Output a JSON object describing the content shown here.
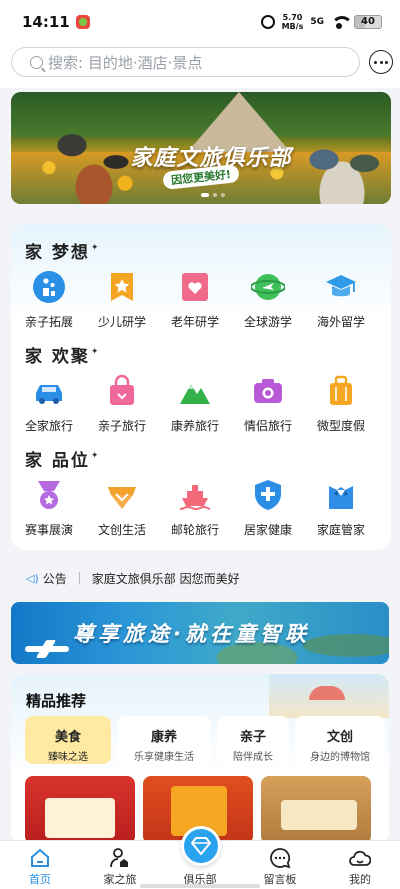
{
  "status_bar": {
    "time": "14:11",
    "speed": "5.70",
    "speed_unit": "MB/s",
    "network": "5G",
    "battery": "40",
    "battery_level": 0.4
  },
  "search": {
    "placeholder": "搜索: 目的地·酒店·景点"
  },
  "banner": {
    "title": "家庭文旅俱乐部",
    "subtitle": "因您更美好!",
    "slide_count": 3,
    "active_slide": 0
  },
  "sections": [
    {
      "title": "家 梦想",
      "items": [
        {
          "label": "亲子拓展",
          "icon": "parent-child-icon",
          "color": "#2a90e6"
        },
        {
          "label": "少儿研学",
          "icon": "bookmark-star-icon",
          "color": "#f5a524"
        },
        {
          "label": "老年研学",
          "icon": "heart-card-icon",
          "color": "#f06b8a"
        },
        {
          "label": "全球游学",
          "icon": "globe-plane-icon",
          "color": "#3fbf5a"
        },
        {
          "label": "海外留学",
          "icon": "graduation-cap-icon",
          "color": "#2f9be8"
        }
      ]
    },
    {
      "title": "家 欢聚",
      "items": [
        {
          "label": "全家旅行",
          "icon": "car-icon",
          "color": "#2a8de6"
        },
        {
          "label": "亲子旅行",
          "icon": "shopping-bag-icon",
          "color": "#f0679a"
        },
        {
          "label": "康养旅行",
          "icon": "mountain-icon",
          "color": "#33b24a"
        },
        {
          "label": "情侣旅行",
          "icon": "camera-icon",
          "color": "#b85ad8"
        },
        {
          "label": "微型度假",
          "icon": "suitcase-icon",
          "color": "#f5a623"
        }
      ]
    },
    {
      "title": "家 品位",
      "items": [
        {
          "label": "赛事展演",
          "icon": "medal-icon",
          "color": "#b66ae0"
        },
        {
          "label": "文创生活",
          "icon": "gem-box-icon",
          "color": "#f4a12a"
        },
        {
          "label": "邮轮旅行",
          "icon": "cruise-ship-icon",
          "color": "#f36a7a"
        },
        {
          "label": "居家健康",
          "icon": "medical-shield-icon",
          "color": "#2a8de6"
        },
        {
          "label": "家庭管家",
          "icon": "butler-icon",
          "color": "#2f8fe6"
        }
      ]
    }
  ],
  "notice": {
    "label": "公告",
    "text": "家庭文旅俱乐部 因您而美好"
  },
  "promo": {
    "text": "尊享旅途·就在童智联"
  },
  "recommend": {
    "title": "精品推荐",
    "tabs": [
      {
        "title": "美食",
        "sub": "臻味之选",
        "active": true
      },
      {
        "title": "康养",
        "sub": "乐享健康生活",
        "active": false
      },
      {
        "title": "亲子",
        "sub": "陪伴成长",
        "active": false
      },
      {
        "title": "文创",
        "sub": "身边的博物馆",
        "active": false
      }
    ]
  },
  "tabbar": [
    {
      "label": "首页",
      "icon": "home-icon",
      "active": true
    },
    {
      "label": "家之旅",
      "icon": "person-home-icon",
      "active": false
    },
    {
      "label": "俱乐部",
      "icon": "diamond-icon",
      "active": false
    },
    {
      "label": "留言板",
      "icon": "chat-bubble-icon",
      "active": false
    },
    {
      "label": "我的",
      "icon": "cloud-profile-icon",
      "active": false
    }
  ],
  "colors": {
    "accent": "#2a8ee0",
    "active_tab_bg": "#ffe9a3"
  }
}
